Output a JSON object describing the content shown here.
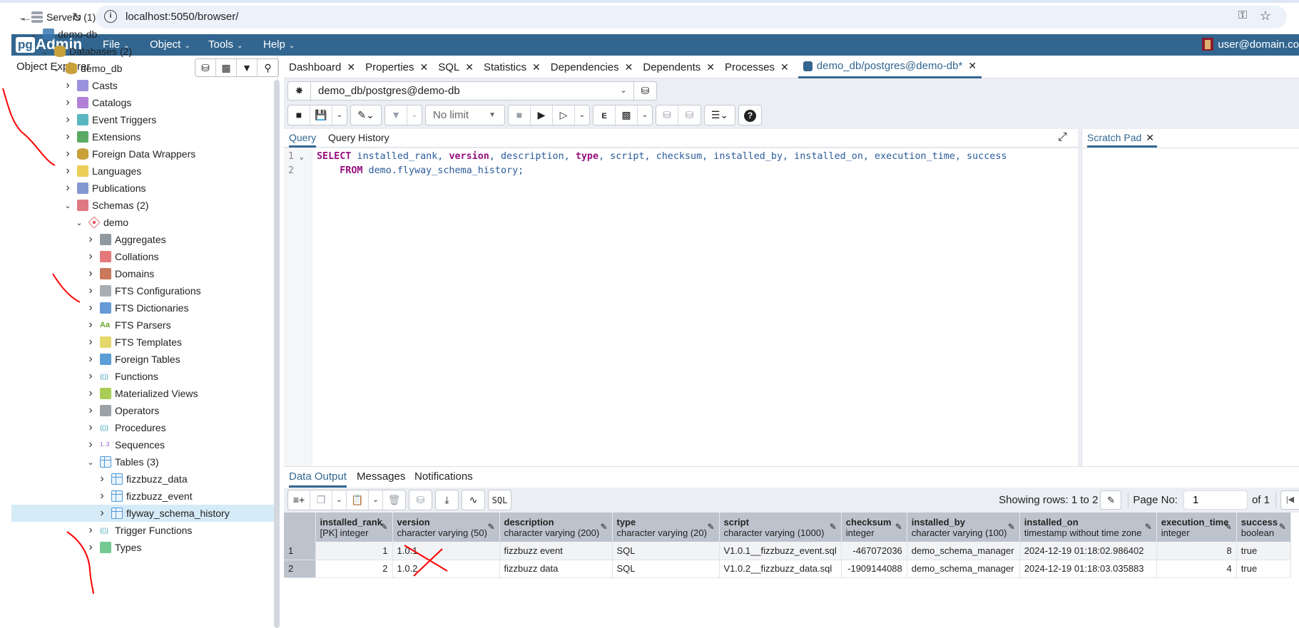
{
  "browser": {
    "url": "localhost:5050/browser/",
    "back_icon": "arrow-left-icon",
    "forward_icon": "arrow-right-icon",
    "reload_icon": "reload-icon"
  },
  "app": {
    "logo_pg": "pg",
    "logo_admin": "Admin",
    "menus": [
      "File",
      "Object",
      "Tools",
      "Help"
    ],
    "user": "user@domain.co",
    "accent": "#326690"
  },
  "sidebar": {
    "title": "Object Explorer",
    "tools": [
      "query-tool-icon",
      "view-data-icon",
      "filtered-rows-icon",
      "search-icon"
    ],
    "tree": [
      {
        "label": "Servers",
        "count": "(1)",
        "level": 0,
        "expanded": true,
        "icon": "servers-icon"
      },
      {
        "label": "demo-db",
        "count": "",
        "level": 1,
        "expanded": true,
        "icon": "server-icon"
      },
      {
        "label": "Databases",
        "count": "(2)",
        "level": 2,
        "expanded": true,
        "icon": "databases-icon"
      },
      {
        "label": "demo_db",
        "count": "",
        "level": 3,
        "expanded": true,
        "icon": "database-icon"
      },
      {
        "label": "Casts",
        "count": "",
        "level": 4,
        "expanded": false,
        "icon": "casts-icon"
      },
      {
        "label": "Catalogs",
        "count": "",
        "level": 4,
        "expanded": false,
        "icon": "catalogs-icon"
      },
      {
        "label": "Event Triggers",
        "count": "",
        "level": 4,
        "expanded": false,
        "icon": "event-triggers-icon"
      },
      {
        "label": "Extensions",
        "count": "",
        "level": 4,
        "expanded": false,
        "icon": "extensions-icon"
      },
      {
        "label": "Foreign Data Wrappers",
        "count": "",
        "level": 4,
        "expanded": false,
        "icon": "foreign-data-wrappers-icon"
      },
      {
        "label": "Languages",
        "count": "",
        "level": 4,
        "expanded": false,
        "icon": "languages-icon"
      },
      {
        "label": "Publications",
        "count": "",
        "level": 4,
        "expanded": false,
        "icon": "publications-icon"
      },
      {
        "label": "Schemas",
        "count": "(2)",
        "level": 4,
        "expanded": true,
        "icon": "schemas-icon"
      },
      {
        "label": "demo",
        "count": "",
        "level": 5,
        "expanded": true,
        "icon": "schema-icon"
      },
      {
        "label": "Aggregates",
        "count": "",
        "level": 6,
        "expanded": false,
        "icon": "aggregates-icon"
      },
      {
        "label": "Collations",
        "count": "",
        "level": 6,
        "expanded": false,
        "icon": "collations-icon"
      },
      {
        "label": "Domains",
        "count": "",
        "level": 6,
        "expanded": false,
        "icon": "domains-icon"
      },
      {
        "label": "FTS Configurations",
        "count": "",
        "level": 6,
        "expanded": false,
        "icon": "fts-configurations-icon"
      },
      {
        "label": "FTS Dictionaries",
        "count": "",
        "level": 6,
        "expanded": false,
        "icon": "fts-dictionaries-icon"
      },
      {
        "label": "FTS Parsers",
        "count": "",
        "level": 6,
        "expanded": false,
        "icon": "fts-parsers-icon"
      },
      {
        "label": "FTS Templates",
        "count": "",
        "level": 6,
        "expanded": false,
        "icon": "fts-templates-icon"
      },
      {
        "label": "Foreign Tables",
        "count": "",
        "level": 6,
        "expanded": false,
        "icon": "foreign-tables-icon"
      },
      {
        "label": "Functions",
        "count": "",
        "level": 6,
        "expanded": false,
        "icon": "functions-icon"
      },
      {
        "label": "Materialized Views",
        "count": "",
        "level": 6,
        "expanded": false,
        "icon": "materialized-views-icon"
      },
      {
        "label": "Operators",
        "count": "",
        "level": 6,
        "expanded": false,
        "icon": "operators-icon"
      },
      {
        "label": "Procedures",
        "count": "",
        "level": 6,
        "expanded": false,
        "icon": "procedures-icon"
      },
      {
        "label": "Sequences",
        "count": "",
        "level": 6,
        "expanded": false,
        "icon": "sequences-icon"
      },
      {
        "label": "Tables",
        "count": "(3)",
        "level": 6,
        "expanded": true,
        "icon": "tables-icon"
      },
      {
        "label": "fizzbuzz_data",
        "count": "",
        "level": 7,
        "expanded": false,
        "icon": "table-icon"
      },
      {
        "label": "fizzbuzz_event",
        "count": "",
        "level": 7,
        "expanded": false,
        "icon": "table-icon"
      },
      {
        "label": "flyway_schema_history",
        "count": "",
        "level": 7,
        "expanded": false,
        "icon": "table-icon",
        "selected": true
      },
      {
        "label": "Trigger Functions",
        "count": "",
        "level": 6,
        "expanded": false,
        "icon": "trigger-functions-icon"
      },
      {
        "label": "Types",
        "count": "",
        "level": 6,
        "expanded": false,
        "icon": "types-icon"
      }
    ]
  },
  "tabs": [
    {
      "label": "Dashboard",
      "active": false
    },
    {
      "label": "Properties",
      "active": false
    },
    {
      "label": "SQL",
      "active": false
    },
    {
      "label": "Statistics",
      "active": false
    },
    {
      "label": "Dependencies",
      "active": false
    },
    {
      "label": "Dependents",
      "active": false
    },
    {
      "label": "Processes",
      "active": false
    },
    {
      "label": "demo_db/postgres@demo-db*",
      "active": true
    }
  ],
  "query_tool": {
    "connection": "demo_db/postgres@demo-db",
    "limit": "No limit",
    "query_tabs": [
      "Query",
      "Query History"
    ],
    "scratch_pad": "Scratch Pad",
    "lines": [
      [
        {
          "t": "SELECT",
          "kw": true
        },
        {
          "t": " installed_rank, "
        },
        {
          "t": "version",
          "kw": true
        },
        {
          "t": ", description, "
        },
        {
          "t": "type",
          "kw": true
        },
        {
          "t": ", script, checksum, installed_by, installed_on, execution_time, success"
        }
      ],
      [
        {
          "t": "    "
        },
        {
          "t": "FROM",
          "kw": true
        },
        {
          "t": " demo.flyway_schema_history;"
        }
      ]
    ]
  },
  "results": {
    "tabs": [
      "Data Output",
      "Messages",
      "Notifications"
    ],
    "showing": "Showing rows: 1 to 2",
    "page_label": "Page No:",
    "page_value": "1",
    "page_of": "of 1",
    "columns": [
      {
        "name": "installed_rank",
        "type": "[PK] integer"
      },
      {
        "name": "version",
        "type": "character varying (50)"
      },
      {
        "name": "description",
        "type": "character varying (200)"
      },
      {
        "name": "type",
        "type": "character varying (20)"
      },
      {
        "name": "script",
        "type": "character varying (1000)"
      },
      {
        "name": "checksum",
        "type": "integer"
      },
      {
        "name": "installed_by",
        "type": "character varying (100)"
      },
      {
        "name": "installed_on",
        "type": "timestamp without time zone"
      },
      {
        "name": "execution_time",
        "type": "integer"
      },
      {
        "name": "success",
        "type": "boolean"
      }
    ],
    "rows": [
      [
        "1",
        "1",
        "1.0.1",
        "fizzbuzz event",
        "SQL",
        "V1.0.1__fizzbuzz_event.sql",
        "-467072036",
        "demo_schema_manager",
        "2024-12-19 01:18:02.986402",
        "8",
        "true"
      ],
      [
        "2",
        "2",
        "1.0.2",
        "fizzbuzz data",
        "SQL",
        "V1.0.2__fizzbuzz_data.sql",
        "-1909144088",
        "demo_schema_manager",
        "2024-12-19 01:18:03.035883",
        "4",
        "true"
      ]
    ]
  }
}
